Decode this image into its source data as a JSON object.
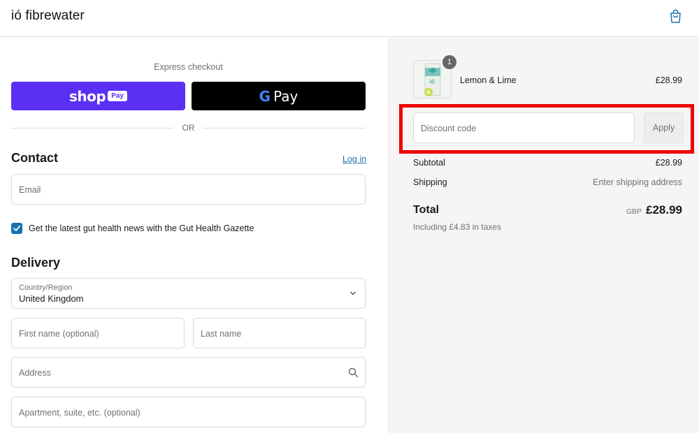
{
  "header": {
    "brand": "ió fibrewater",
    "cart_icon": "shopping-bag-icon"
  },
  "express": {
    "label": "Express checkout",
    "shop_pay": {
      "word": "shop",
      "pill": "Pay"
    },
    "google_pay": {
      "g": "G",
      "word": "Pay"
    },
    "or_text": "OR"
  },
  "contact": {
    "title": "Contact",
    "login_link": "Log in",
    "email_placeholder": "Email",
    "newsletter_label": "Get the latest gut health news with the Gut Health Gazette",
    "newsletter_checked": true
  },
  "delivery": {
    "title": "Delivery",
    "country_label": "Country/Region",
    "country_value": "United Kingdom",
    "first_name_placeholder": "First name (optional)",
    "last_name_placeholder": "Last name",
    "address_placeholder": "Address",
    "apartment_placeholder": "Apartment, suite, etc. (optional)"
  },
  "summary": {
    "item": {
      "name": "Lemon & Lime",
      "price": "£28.99",
      "quantity": "1"
    },
    "discount_placeholder": "Discount code",
    "apply_label": "Apply",
    "subtotal_label": "Subtotal",
    "subtotal_value": "£28.99",
    "shipping_label": "Shipping",
    "shipping_value": "Enter shipping address",
    "total_label": "Total",
    "currency": "GBP",
    "total_value": "£28.99",
    "taxes_note": "Including £4.83 in taxes"
  },
  "colors": {
    "shop_pay": "#5a31f4",
    "google_pay": "#000000",
    "link": "#1773b0",
    "highlight": "#ee0000"
  }
}
